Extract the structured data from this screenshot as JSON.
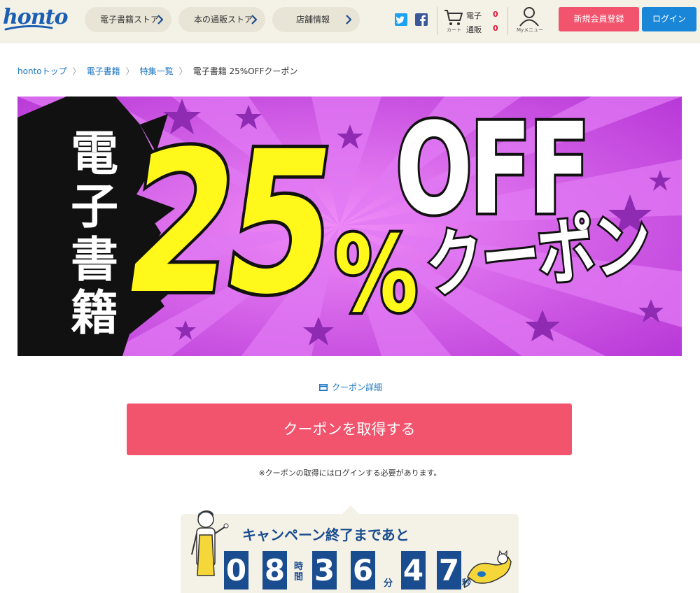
{
  "header": {
    "logo": "honto",
    "nav": [
      {
        "label": "電子書籍ストア"
      },
      {
        "label": "本の通販ストア"
      },
      {
        "label": "店舗情報"
      }
    ],
    "cart": {
      "label": "カート",
      "ebook_label": "電子",
      "ebook_count": "0",
      "physical_label": "通販",
      "physical_count": "0"
    },
    "mymenu_label": "Myメニュー",
    "register_label": "新規会員登録",
    "login_label": "ログイン"
  },
  "breadcrumb": [
    {
      "label": "hontoトップ"
    },
    {
      "label": "電子書籍"
    },
    {
      "label": "特集一覧"
    },
    {
      "label": "電子書籍 25%OFFクーポン"
    }
  ],
  "banner": {
    "line1": "電子書籍",
    "big_number": "25",
    "percent": "%",
    "off": "OFF",
    "coupon": "クーポン"
  },
  "coupon_detail_label": "クーポン詳細",
  "get_coupon_label": "クーポンを取得する",
  "login_note": "※クーポンの取得にはログインする必要があります。",
  "countdown": {
    "title": "キャンペーン終了まであと",
    "hours": [
      "0",
      "8"
    ],
    "hours_unit": "時間",
    "minutes": [
      "3",
      "6"
    ],
    "minutes_unit": "分",
    "seconds": [
      "4",
      "7"
    ],
    "seconds_unit": "秒"
  },
  "colors": {
    "header_bg": "#f4f1e6",
    "brand_blue": "#1a5fb4",
    "accent_pink": "#f2546d",
    "login_blue": "#1a86d8",
    "banner_purple": "#d04ee6",
    "countdown_navy": "#1a4d8f"
  }
}
